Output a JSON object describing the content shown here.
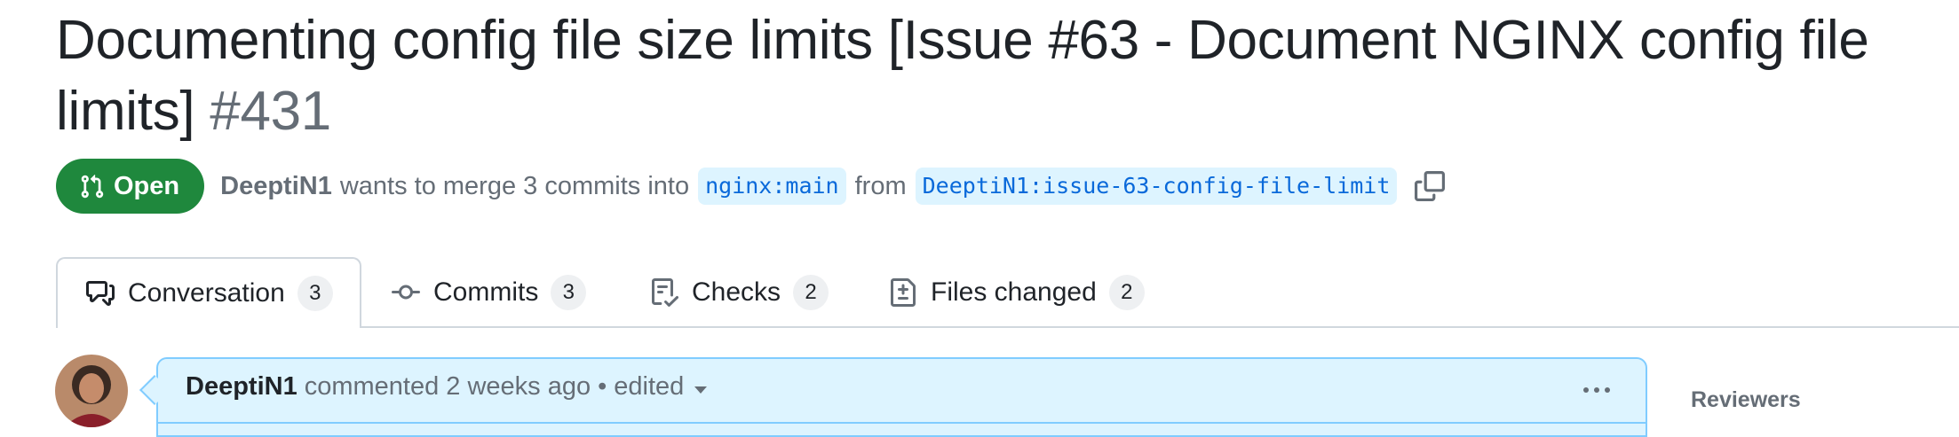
{
  "pr": {
    "title": "Documenting config file size limits [Issue #63 - Document NGINX config file limits]",
    "number": "#431",
    "state": "Open",
    "author": "DeeptiN1",
    "summary_text": "wants to merge 3 commits into",
    "base_branch": "nginx:main",
    "from_text": "from",
    "head_branch": "DeeptiN1:issue-63-config-file-limit"
  },
  "tabs": [
    {
      "label": "Conversation",
      "count": "3",
      "icon": "comment-discussion-icon",
      "selected": true
    },
    {
      "label": "Commits",
      "count": "3",
      "icon": "git-commit-icon",
      "selected": false
    },
    {
      "label": "Checks",
      "count": "2",
      "icon": "checklist-icon",
      "selected": false
    },
    {
      "label": "Files changed",
      "count": "2",
      "icon": "file-diff-icon",
      "selected": false
    }
  ],
  "comment": {
    "author": "DeeptiN1",
    "action": "commented",
    "time": "2 weeks ago",
    "separator": "•",
    "edited": "edited"
  },
  "sidebar": {
    "reviewers_label": "Reviewers"
  },
  "colors": {
    "open_green": "#1f883d",
    "branch_bg": "#ddf4ff",
    "branch_text": "#0969da",
    "comment_header_bg": "#ddf4ff"
  }
}
